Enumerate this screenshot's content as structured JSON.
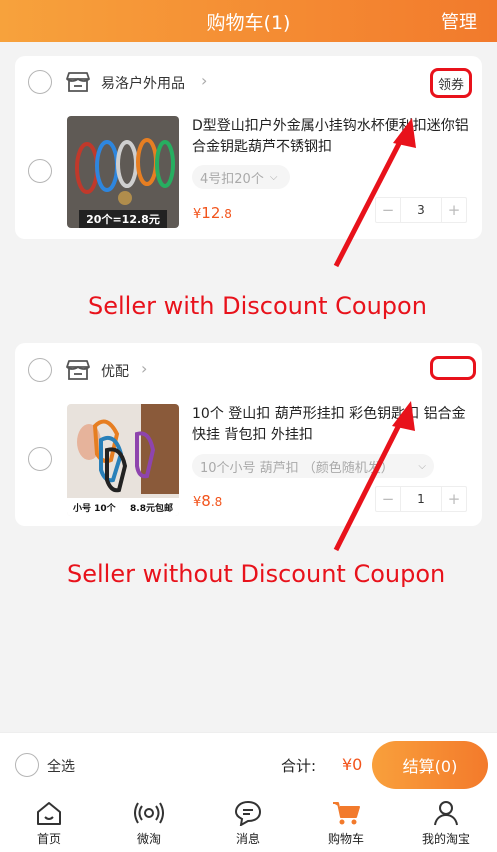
{
  "header": {
    "title": "购物车(1)",
    "manage": "管理"
  },
  "stores": [
    {
      "name": "易洛户外用品",
      "coupon_label": "领券",
      "product": {
        "title": "D型登山扣户外金属小挂钩水杯便利扣迷你铝合金钥匙葫芦不锈钢扣",
        "sku": "4号扣20个",
        "price_symbol": "¥",
        "price_int": "12",
        "price_dec": ".8",
        "qty": "3",
        "thumb_caption": "20个=12.8元"
      }
    },
    {
      "name": "优配",
      "product": {
        "title": "10个 登山扣 葫芦形挂扣 彩色钥匙扣 铝合金快挂 背包扣 外挂扣",
        "sku": "10个小号 葫芦扣 （颜色随机发）",
        "price_symbol": "¥",
        "price_int": "8",
        "price_dec": ".8",
        "qty": "1",
        "thumb_caption_left": "小号 10个",
        "thumb_caption_right": "8.8元包邮"
      }
    }
  ],
  "annotations": {
    "with_coupon": "Seller with Discount Coupon",
    "without_coupon": "Seller without Discount Coupon"
  },
  "checkout": {
    "select_all": "全选",
    "total_label": "合计:",
    "total_amount": "¥0",
    "button": "结算(0)"
  },
  "tabbar": [
    "首页",
    "微淘",
    "消息",
    "购物车",
    "我的淘宝"
  ],
  "colors": {
    "accent": "#f27a2c",
    "price": "#f2541c",
    "annotation": "#e8121b"
  }
}
